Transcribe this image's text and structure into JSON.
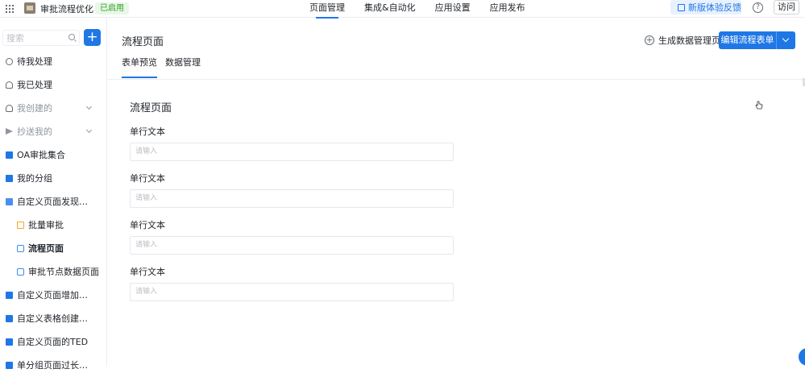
{
  "topbar": {
    "app_name": "审批流程优化",
    "status_badge": "已启用",
    "tabs": [
      "页面管理",
      "集成&自动化",
      "应用设置",
      "应用发布"
    ],
    "active_tab": 0,
    "feedback_label": "新版体验反馈",
    "help_icon": "?",
    "visit_label": "访问"
  },
  "sidebar": {
    "search_placeholder": "搜索",
    "add_icon": "+",
    "items": [
      {
        "label": "待我处理",
        "icon": "clock-icon"
      },
      {
        "label": "我已处理",
        "icon": "user-icon"
      },
      {
        "label": "我创建的",
        "icon": "user-icon",
        "muted": true,
        "chevron": true
      },
      {
        "label": "抄送我的",
        "icon": "send-icon",
        "muted": true,
        "chevron": true
      },
      {
        "label": "OA审批集合",
        "icon": "folder-icon"
      },
      {
        "label": "我的分组",
        "icon": "folder-icon"
      },
      {
        "label": "自定义页面发现批量...",
        "icon": "folder-open-icon"
      },
      {
        "label": "批量审批",
        "icon": "form-icon",
        "child": true
      },
      {
        "label": "流程页面",
        "icon": "flow-icon",
        "child": true,
        "active": true
      },
      {
        "label": "审批节点数据页面",
        "icon": "flow-icon",
        "child": true
      },
      {
        "label": "自定义页面增加内容",
        "icon": "folder-icon"
      },
      {
        "label": "自定义表格创建表单和...",
        "icon": "folder-icon"
      },
      {
        "label": "自定义页面的TED",
        "icon": "folder-icon"
      },
      {
        "label": "单分组页面过长时候...",
        "icon": "folder-icon"
      }
    ]
  },
  "main": {
    "page_title": "流程页面",
    "generate_link": "生成数据管理页",
    "plus_icon": "+",
    "edit_button": "编辑流程表单",
    "sub_tabs": [
      "表单预览",
      "数据管理"
    ],
    "active_sub_tab": 0,
    "form": {
      "title": "流程页面",
      "fields": [
        {
          "label": "单行文本",
          "placeholder": "请输入"
        },
        {
          "label": "单行文本",
          "placeholder": "请输入"
        },
        {
          "label": "单行文本",
          "placeholder": "请输入"
        },
        {
          "label": "单行文本",
          "placeholder": "请输入"
        }
      ]
    }
  },
  "colors": {
    "accent": "#1f77e6",
    "badge_green": "#2ea121"
  }
}
